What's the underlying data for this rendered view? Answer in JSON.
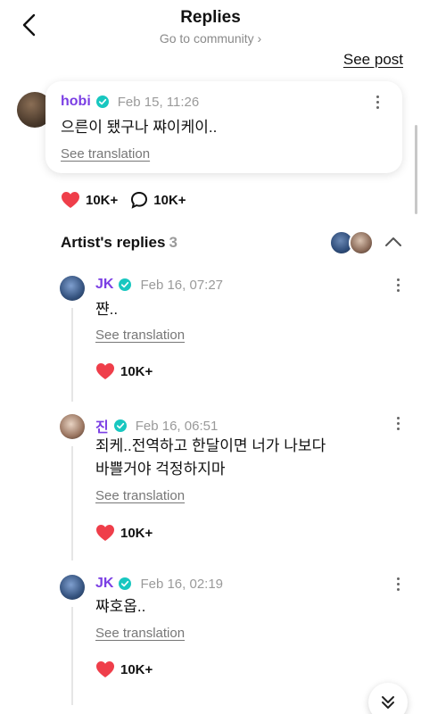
{
  "header": {
    "title": "Replies",
    "community_link": "Go to community ›",
    "see_post": "See post"
  },
  "post": {
    "author": "hobi",
    "date": "Feb 15, 11:26",
    "text": "으른이 됐구나 쨔이케이..",
    "translate": "See translation",
    "likes": "10K+",
    "comments": "10K+"
  },
  "artist_replies": {
    "title": "Artist's replies",
    "count": "3",
    "items": [
      {
        "author": "JK",
        "date": "Feb 16, 07:27",
        "lines": [
          "쨘.."
        ],
        "translate": "See translation",
        "likes": "10K+"
      },
      {
        "author": "진",
        "date": "Feb 16, 06:51",
        "lines": [
          "죄케..전역하고 한달이면 너가 나보다",
          "바쁠거야 걱정하지마"
        ],
        "translate": "See translation",
        "likes": "10K+"
      },
      {
        "author": "JK",
        "date": "Feb 16, 02:19",
        "lines": [
          "쨔호옵.."
        ],
        "translate": "See translation",
        "likes": "10K+"
      }
    ]
  },
  "colors": {
    "accent_purple": "#7b3fe4",
    "verified_teal": "#18c7c0",
    "heart_red": "#ef3e4a"
  },
  "icons": {
    "back": "chevron-left-icon",
    "verified": "verified-badge-icon",
    "more": "more-vertical-icon",
    "like": "heart-icon",
    "comment": "comment-bubble-icon",
    "collapse": "chevron-up-icon",
    "scroll": "double-chevron-down-icon"
  }
}
